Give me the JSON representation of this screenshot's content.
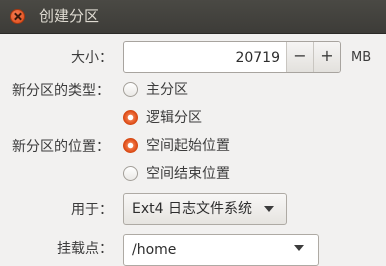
{
  "window": {
    "title": "创建分区"
  },
  "size": {
    "label": "大小：",
    "value": "20719",
    "decrement": "−",
    "increment": "+",
    "unit": "MB"
  },
  "partition_type": {
    "label": "新分区的类型：",
    "options": [
      {
        "label": "主分区",
        "selected": false
      },
      {
        "label": "逻辑分区",
        "selected": true
      }
    ]
  },
  "partition_position": {
    "label": "新分区的位置：",
    "options": [
      {
        "label": "空间起始位置",
        "selected": true
      },
      {
        "label": "空间结束位置",
        "selected": false
      }
    ]
  },
  "use_as": {
    "label": "用于：",
    "value": "Ext4 日志文件系统"
  },
  "mount_point": {
    "label": "挂载点：",
    "value": "/home"
  },
  "colors": {
    "titlebar": "#3d3c38",
    "accent": "#dd4814",
    "background": "#f2f1f0"
  }
}
